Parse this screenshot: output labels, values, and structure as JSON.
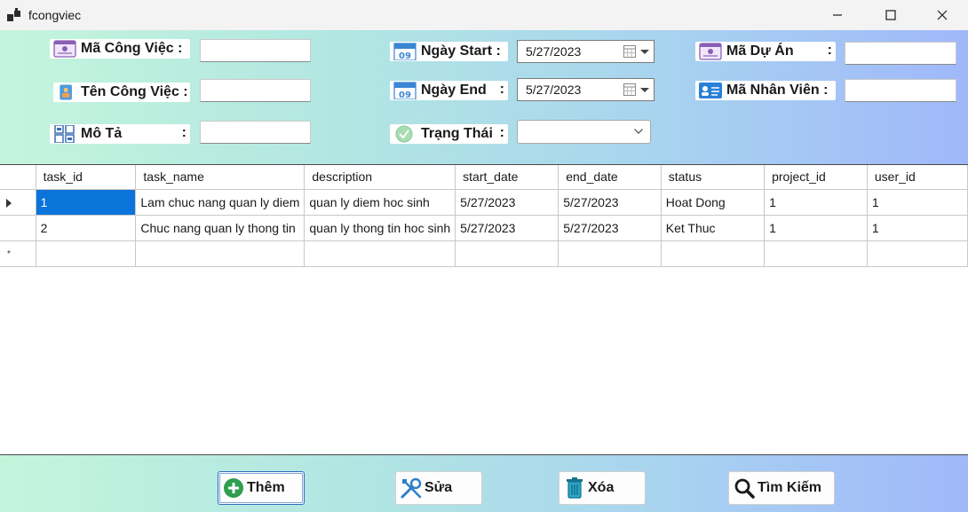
{
  "window": {
    "title": "fcongviec"
  },
  "form": {
    "ma_cong_viec": {
      "label": "Mã Công Việc :",
      "value": ""
    },
    "ten_cong_viec": {
      "label": "Tên Công Việc :",
      "value": ""
    },
    "mo_ta": {
      "label": "Mô Tả",
      "colon": ":",
      "value": ""
    },
    "ngay_start": {
      "label": "Ngày Start :",
      "value": "5/27/2023"
    },
    "ngay_end": {
      "label": "Ngày End",
      "colon": ":",
      "value": "5/27/2023"
    },
    "trang_thai": {
      "label": "Trạng Thái",
      "colon": ":",
      "value": ""
    },
    "ma_du_an": {
      "label": "Mã Dự Án",
      "colon": ":",
      "value": ""
    },
    "ma_nhan_vien": {
      "label": "Mã Nhân Viên :",
      "value": ""
    },
    "calendar_badge": "09"
  },
  "grid": {
    "columns": [
      "task_id",
      "task_name",
      "description",
      "start_date",
      "end_date",
      "status",
      "project_id",
      "user_id"
    ],
    "rows": [
      [
        "1",
        "Lam chuc nang quan ly diem",
        "quan ly diem hoc sinh",
        "5/27/2023",
        "5/27/2023",
        "Hoat Dong",
        "1",
        "1"
      ],
      [
        "2",
        "Chuc nang quan ly thong tin",
        "quan ly thong tin hoc sinh",
        "5/27/2023",
        "5/27/2023",
        "Ket Thuc",
        "1",
        "1"
      ]
    ],
    "new_row_marker": "*"
  },
  "buttons": {
    "them": "Thêm",
    "sua": "Sửa",
    "xoa": "Xóa",
    "tim_kiem": "Tìm Kiếm"
  },
  "colors": {
    "selection": "#0a74da",
    "gradient_start": "#c4f5dc",
    "gradient_end": "#a0b8fa",
    "add_icon": "#2e9e4f"
  },
  "icons": [
    "app-icon",
    "minimize-icon",
    "maximize-icon",
    "close-icon",
    "id-card-icon",
    "person-badge-icon",
    "list-grid-icon",
    "calendar-icon",
    "checkmark-circle-icon",
    "contact-card-icon",
    "plus-circle-icon",
    "tools-icon",
    "trash-icon",
    "magnifier-icon"
  ]
}
